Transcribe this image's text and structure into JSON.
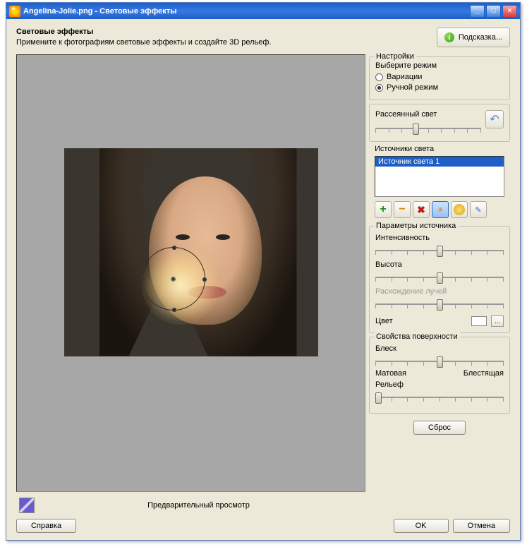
{
  "titlebar": {
    "text": "Angelina-Jolie.png - Световые эффекты"
  },
  "header": {
    "title": "Световые эффекты",
    "subtitle": "Примените к фотографиям световые эффекты и создайте 3D рельеф.",
    "hint_label": "Подсказка..."
  },
  "preview": {
    "label": "Предварительный просмотр"
  },
  "settings": {
    "legend": "Настройки",
    "mode_label": "Выберите режим",
    "mode_variations": "Вариации",
    "mode_manual": "Ручной режим",
    "mode_selected": "manual",
    "ambient_label": "Рассеянный свет",
    "sources_label": "Источники света",
    "sources": [
      "Источник света 1"
    ],
    "params": {
      "legend": "Параметры источника",
      "intensity": "Интенсивность",
      "height": "Высота",
      "spread": "Расхождение лучей",
      "color": "Цвет",
      "color_value": "#ffffff"
    },
    "surface": {
      "legend": "Свойства поверхности",
      "gloss": "Блеск",
      "matte": "Матовая",
      "shiny": "Блестящая",
      "relief": "Рельеф"
    },
    "reset": "Сброс"
  },
  "buttons": {
    "help": "Справка",
    "ok": "OK",
    "cancel": "Отмена"
  }
}
